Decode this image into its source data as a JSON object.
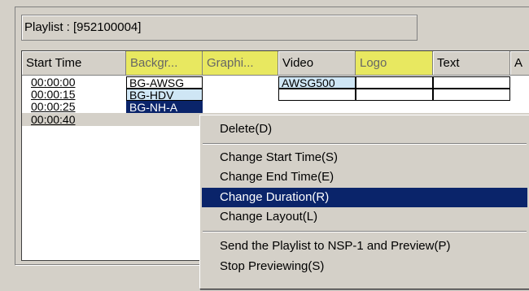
{
  "playlist": {
    "label": "Playlist : [952100004]"
  },
  "grid": {
    "columns": [
      "Start Time",
      "Backgr...",
      "Graphi...",
      "Video",
      "Logo",
      "Text",
      "A"
    ],
    "rows": [
      {
        "start": "00:00:00",
        "background": "BG-AWSG",
        "video": "AWSG500"
      },
      {
        "start": "00:00:15",
        "background": "BG-HDV",
        "video": ""
      },
      {
        "start": "00:00:25",
        "background": "BG-NH-A",
        "video": ""
      },
      {
        "start": "00:00:40",
        "background": "",
        "video": ""
      }
    ]
  },
  "context_menu": {
    "items": [
      "Delete(D)",
      "Change Start Time(S)",
      "Change End Time(E)",
      "Change Duration(R)",
      "Change Layout(L)",
      "Send the Playlist to NSP-1 and Preview(P)",
      "Stop Previewing(S)"
    ]
  },
  "colors": {
    "highlight_header": "#e8e860",
    "selection": "#0a246a",
    "cell_blue": "#cfe6f5"
  }
}
